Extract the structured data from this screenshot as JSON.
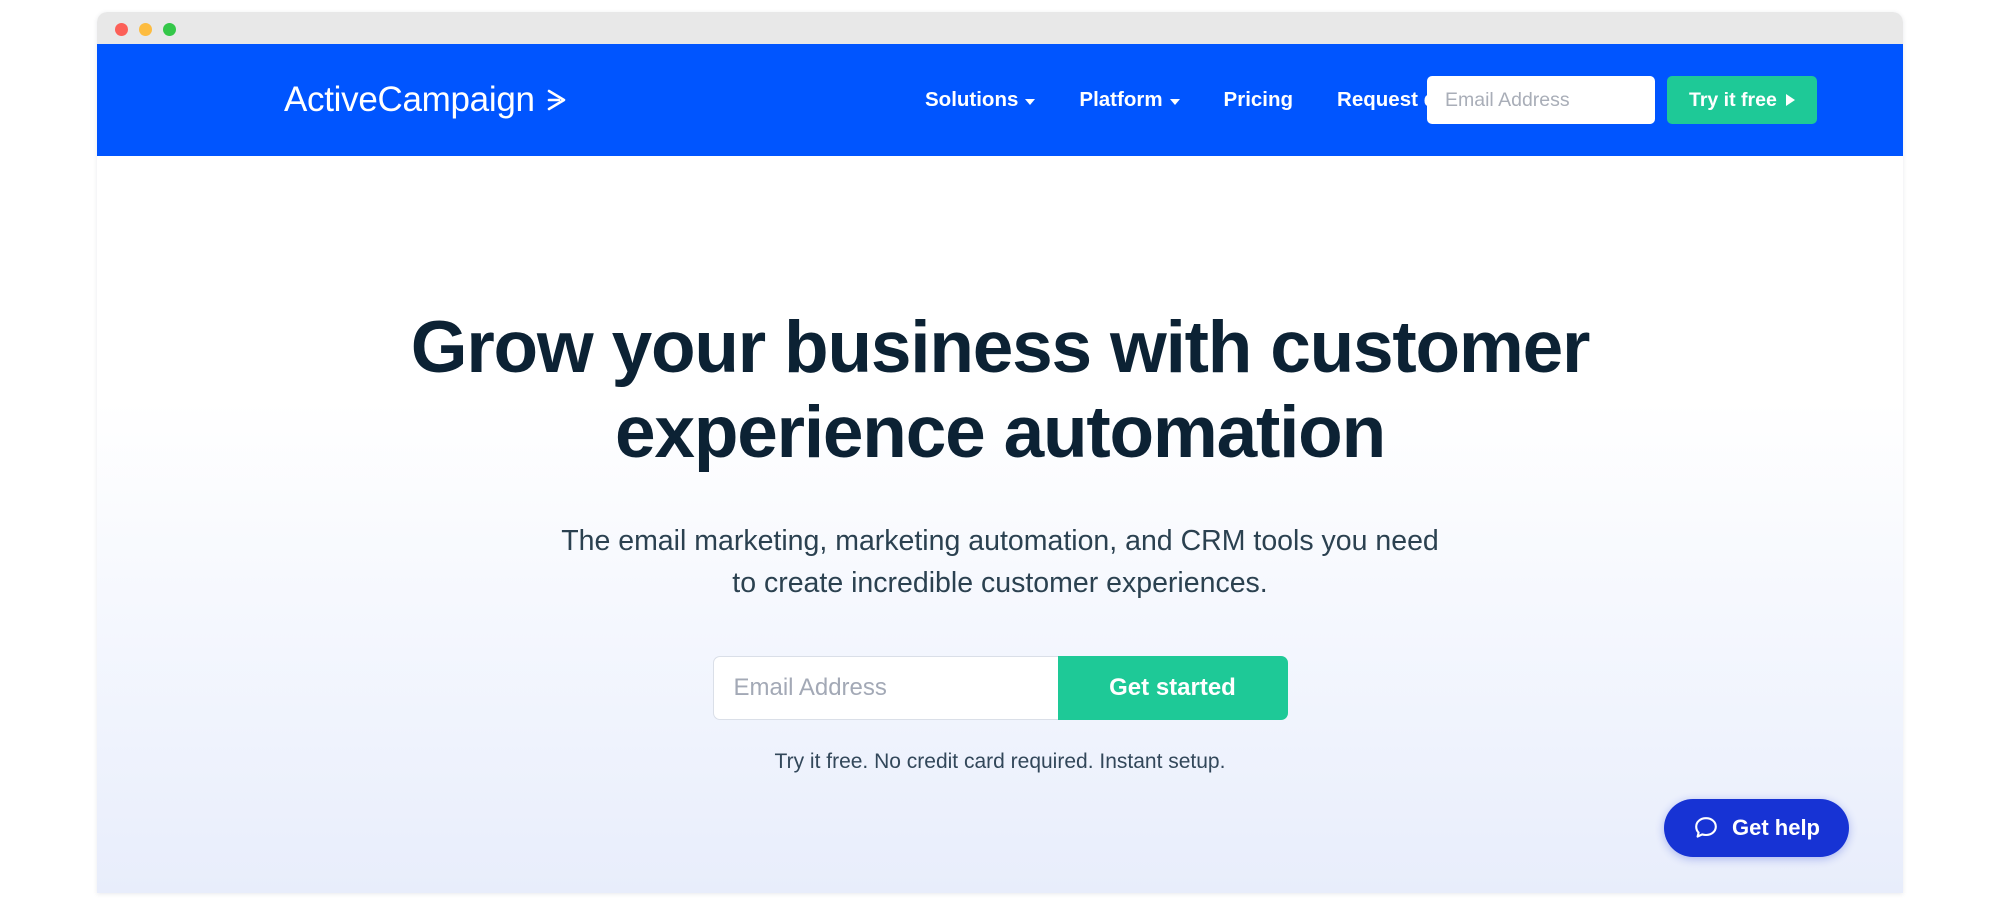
{
  "window": {
    "traffic_lights": [
      {
        "name": "close",
        "color": "#fc6058"
      },
      {
        "name": "minimize",
        "color": "#fdbc40"
      },
      {
        "name": "maximize",
        "color": "#34c749"
      }
    ]
  },
  "theme": {
    "nav_blue": "#0055ff",
    "accent_green": "#1ec997",
    "headline_navy": "#0c2234",
    "help_blue": "#1733d4",
    "page_gradient_top": "#ffffff",
    "page_gradient_bottom": "#e8edfb"
  },
  "navbar": {
    "logo_text": "ActiveCampaign",
    "logo_icon": "chevron-right-arrow-icon",
    "links": [
      {
        "label": "Solutions",
        "has_dropdown": true,
        "icon": "chevron-down-icon"
      },
      {
        "label": "Platform",
        "has_dropdown": true,
        "icon": "chevron-down-icon"
      },
      {
        "label": "Pricing",
        "has_dropdown": false,
        "icon": ""
      },
      {
        "label": "Request demo",
        "has_dropdown": false,
        "icon": ""
      }
    ],
    "email_placeholder": "Email Address",
    "email_value": "",
    "cta_label": "Try it free",
    "cta_icon": "play-triangle-icon"
  },
  "hero": {
    "title": "Grow your business with customer experience automation",
    "subtitle": "The email marketing, marketing automation, and CRM tools you need to create incredible customer experiences.",
    "email_placeholder": "Email Address",
    "email_value": "",
    "submit_label": "Get started",
    "note": "Try it free. No credit card required. Instant setup."
  },
  "support_widget": {
    "label": "Get help",
    "icon": "chat-bubble-icon"
  }
}
